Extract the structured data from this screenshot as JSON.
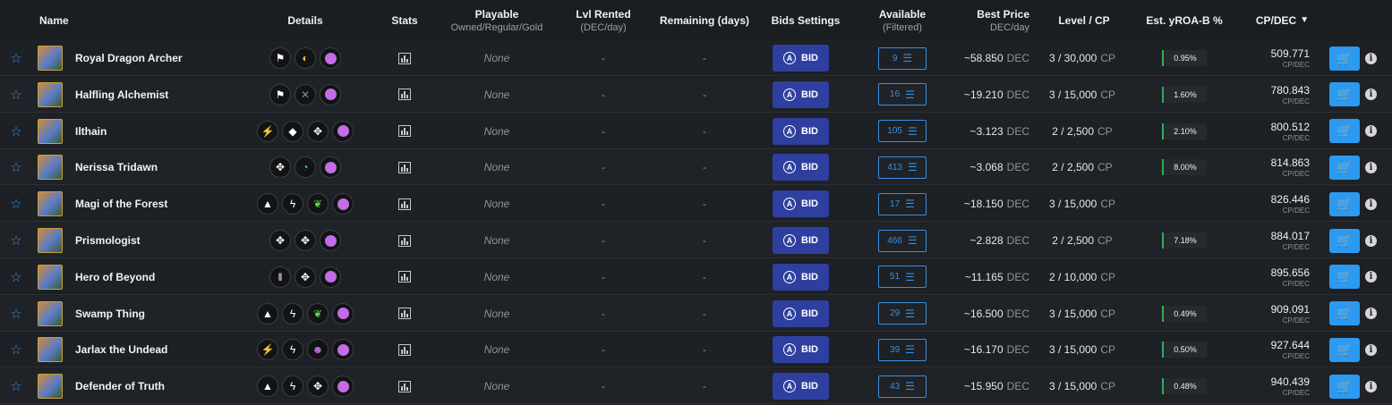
{
  "header": {
    "name": "Name",
    "details": "Details",
    "stats": "Stats",
    "playable": "Playable",
    "playable_sub": "Owned/Regular/Gold",
    "rented": "Lvl Rented",
    "rented_sub": "(DEC/day)",
    "remaining": "Remaining (days)",
    "bids": "Bids Settings",
    "available": "Available",
    "available_sub": "(Filtered)",
    "best_price": "Best Price",
    "best_price_sub": "DEC/day",
    "level": "Level / CP",
    "yroa": "Est. yROA-B %",
    "cpdec": "CP/DEC",
    "sort_icon": "chevron-down-icon"
  },
  "labels": {
    "bid": "BID",
    "currency": "DEC",
    "cp": "CP",
    "cpdec_unit": "CP/DEC",
    "star_icon": "star-outline-icon",
    "cart_icon": "cart-plus-icon",
    "info_icon": "info-icon"
  },
  "colors": {
    "accent_blue": "#2b9af0",
    "bid_button": "#2f3fa0",
    "yroa_bar": "#2fae5a",
    "ability_dot": "#c36ce6"
  },
  "rows": [
    {
      "name": "Royal Dragon Archer",
      "playable": "None",
      "rented": "-",
      "remaining": "-",
      "available": "9",
      "price": "~58.850",
      "level": "3 / 30,000",
      "yroa": "0.95%",
      "cpdec": "509.771"
    },
    {
      "name": "Halfling Alchemist",
      "playable": "None",
      "rented": "-",
      "remaining": "-",
      "available": "16",
      "price": "~19.210",
      "level": "3 / 15,000",
      "yroa": "1.60%",
      "cpdec": "780.843"
    },
    {
      "name": "Ilthain",
      "playable": "None",
      "rented": "-",
      "remaining": "-",
      "available": "105",
      "price": "~3.123",
      "level": "2 / 2,500",
      "yroa": "2.10%",
      "cpdec": "800.512"
    },
    {
      "name": "Nerissa Tridawn",
      "playable": "None",
      "rented": "-",
      "remaining": "-",
      "available": "413",
      "price": "~3.068",
      "level": "2 / 2,500",
      "yroa": "8.00%",
      "cpdec": "814.863"
    },
    {
      "name": "Magi of the Forest",
      "playable": "None",
      "rented": "-",
      "remaining": "-",
      "available": "17",
      "price": "~18.150",
      "level": "3 / 15,000",
      "yroa": "",
      "cpdec": "826.446"
    },
    {
      "name": "Prismologist",
      "playable": "None",
      "rented": "-",
      "remaining": "-",
      "available": "466",
      "price": "~2.828",
      "level": "2 / 2,500",
      "yroa": "7.18%",
      "cpdec": "884.017"
    },
    {
      "name": "Hero of Beyond",
      "playable": "None",
      "rented": "-",
      "remaining": "-",
      "available": "51",
      "price": "~11.165",
      "level": "2 / 10,000",
      "yroa": "",
      "cpdec": "895.656"
    },
    {
      "name": "Swamp Thing",
      "playable": "None",
      "rented": "-",
      "remaining": "-",
      "available": "29",
      "price": "~16.500",
      "level": "3 / 15,000",
      "yroa": "0.49%",
      "cpdec": "909.091"
    },
    {
      "name": "Jarlax the Undead",
      "playable": "None",
      "rented": "-",
      "remaining": "-",
      "available": "39",
      "price": "~16.170",
      "level": "3 / 15,000",
      "yroa": "0.50%",
      "cpdec": "927.644"
    },
    {
      "name": "Defender of Truth",
      "playable": "None",
      "rented": "-",
      "remaining": "-",
      "available": "43",
      "price": "~15.950",
      "level": "3 / 15,000",
      "yroa": "0.48%",
      "cpdec": "940.439"
    }
  ]
}
